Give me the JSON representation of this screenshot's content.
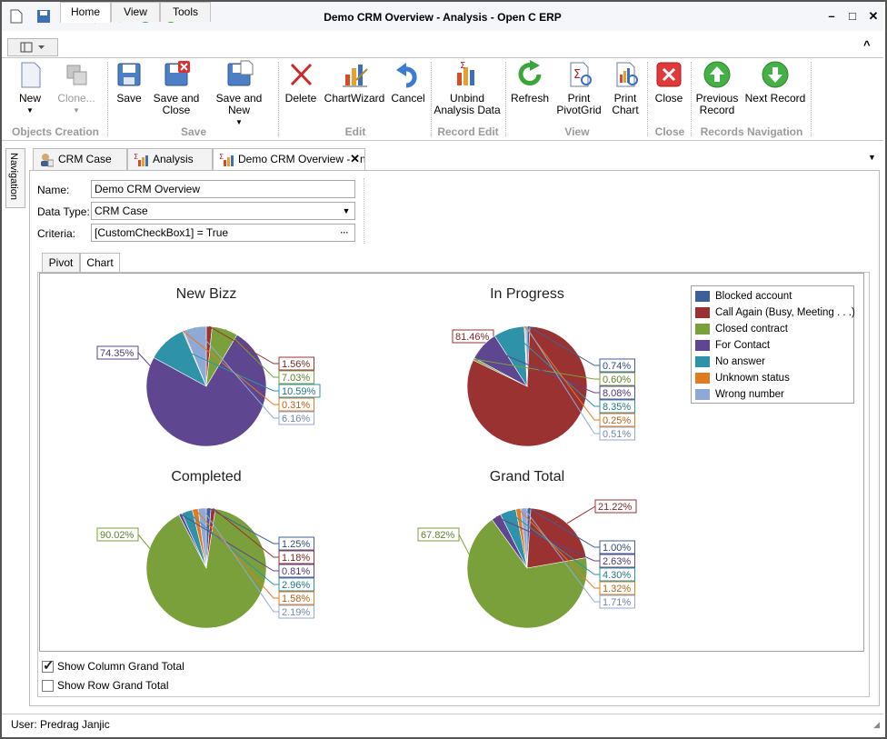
{
  "window": {
    "title": "Demo CRM Overview - Analysis - Open C ERP"
  },
  "ribbon_tabs": [
    "Home",
    "View",
    "Tools"
  ],
  "ribbon": {
    "buttons": {
      "new": "New",
      "clone": "Clone...",
      "save": "Save",
      "save_close_1": "Save and",
      "save_close_2": "Close",
      "save_new": "Save and New",
      "delete": "Delete",
      "chartwizard": "ChartWizard",
      "cancel": "Cancel",
      "unbind_1": "Unbind",
      "unbind_2": "Analysis Data",
      "refresh": "Refresh",
      "print_pivot_1": "Print",
      "print_pivot_2": "PivotGrid",
      "print_chart_1": "Print",
      "print_chart_2": "Chart",
      "close": "Close",
      "prev_1": "Previous",
      "prev_2": "Record",
      "next": "Next Record"
    },
    "groups": {
      "objects": "Objects Creation",
      "save": "Save",
      "edit": "Edit",
      "record_edit": "Record Edit",
      "view": "View",
      "close": "Close",
      "nav": "Records Navigation"
    }
  },
  "sidenav": "Navigation",
  "doc_tabs": [
    "CRM Case",
    "Analysis",
    "Demo CRM Overview - Analysis"
  ],
  "form": {
    "name_label": "Name:",
    "name_value": "Demo CRM Overview",
    "datatype_label": "Data Type:",
    "datatype_value": "CRM Case",
    "criteria_label": "Criteria:",
    "criteria_value": "[CustomCheckBox1] = True"
  },
  "sub_tabs": [
    "Pivot",
    "Chart"
  ],
  "legend_colors": {
    "Blocked account": "#3e5f9a",
    "Call Again (Busy, Meeting . . .)": "#9b3232",
    "Closed contract": "#7aa03c",
    "For Contact": "#5e4690",
    "No answer": "#2e93a8",
    "Unknown status": "#e07b22",
    "Wrong number": "#8fa9d6"
  },
  "chart_data": [
    {
      "type": "pie",
      "title": "New Bizz",
      "values": [
        {
          "name": "Blocked account",
          "label": "",
          "value": 0.0
        },
        {
          "name": "Call Again (Busy, Meeting . . .)",
          "label": "1.56%",
          "value": 1.56
        },
        {
          "name": "Closed contract",
          "label": "7.03%",
          "value": 7.03
        },
        {
          "name": "For Contact",
          "label": "74.35%",
          "value": 74.35
        },
        {
          "name": "No answer",
          "label": "10.59%",
          "value": 10.59
        },
        {
          "name": "Unknown status",
          "label": "0.31%",
          "value": 0.31
        },
        {
          "name": "Wrong number",
          "label": "6.16%",
          "value": 6.16
        }
      ]
    },
    {
      "type": "pie",
      "title": "In Progress",
      "values": [
        {
          "name": "Blocked account",
          "label": "0.74%",
          "value": 0.74
        },
        {
          "name": "Call Again (Busy, Meeting . . .)",
          "label": "81.46%",
          "value": 81.46
        },
        {
          "name": "Closed contract",
          "label": "0.60%",
          "value": 0.6
        },
        {
          "name": "For Contact",
          "label": "8.08%",
          "value": 8.08
        },
        {
          "name": "No answer",
          "label": "8.35%",
          "value": 8.35
        },
        {
          "name": "Unknown status",
          "label": "0.25%",
          "value": 0.25
        },
        {
          "name": "Wrong number",
          "label": "0.51%",
          "value": 0.51
        }
      ]
    },
    {
      "type": "pie",
      "title": "Completed",
      "values": [
        {
          "name": "Blocked account",
          "label": "1.25%",
          "value": 1.25
        },
        {
          "name": "Call Again (Busy, Meeting . . .)",
          "label": "1.18%",
          "value": 1.18
        },
        {
          "name": "Closed contract",
          "label": "90.02%",
          "value": 90.02
        },
        {
          "name": "For Contact",
          "label": "0.81%",
          "value": 0.81
        },
        {
          "name": "No answer",
          "label": "2.96%",
          "value": 2.96
        },
        {
          "name": "Unknown status",
          "label": "1.58%",
          "value": 1.58
        },
        {
          "name": "Wrong number",
          "label": "2.19%",
          "value": 2.19
        }
      ]
    },
    {
      "type": "pie",
      "title": "Grand Total",
      "values": [
        {
          "name": "Blocked account",
          "label": "1.00%",
          "value": 1.0
        },
        {
          "name": "Call Again (Busy, Meeting . . .)",
          "label": "21.22%",
          "value": 21.22
        },
        {
          "name": "Closed contract",
          "label": "67.82%",
          "value": 67.82
        },
        {
          "name": "For Contact",
          "label": "2.63%",
          "value": 2.63
        },
        {
          "name": "No answer",
          "label": "4.30%",
          "value": 4.3
        },
        {
          "name": "Unknown status",
          "label": "1.32%",
          "value": 1.32
        },
        {
          "name": "Wrong number",
          "label": "1.71%",
          "value": 1.71
        }
      ]
    }
  ],
  "checkboxes": {
    "col_total": "Show Column Grand Total",
    "row_total": "Show Row Grand Total",
    "col_checked": true,
    "row_checked": false
  },
  "status": {
    "user": "User: Predrag Janjic"
  }
}
